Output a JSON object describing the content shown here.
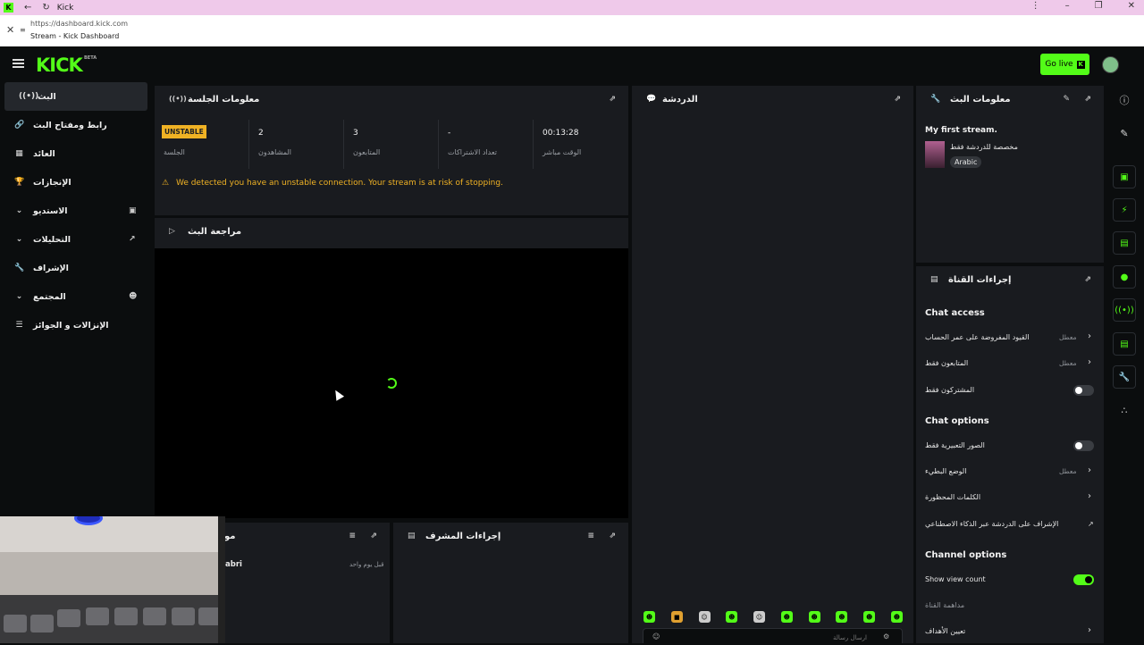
{
  "browser": {
    "tab_title": "Kick",
    "url": "https://dashboard.kick.com",
    "page_title": "Stream - Kick Dashboard"
  },
  "topnav": {
    "logo": "KICK",
    "logo_badge": "BETA",
    "go_live_label": "Go live"
  },
  "sidebar": {
    "items": [
      {
        "label": "البث",
        "icon": "broadcast-icon"
      },
      {
        "label": "رابط ومفتاح البث",
        "icon": "link-icon"
      },
      {
        "label": "العائد",
        "icon": "revenue-icon"
      },
      {
        "label": "الإنجازات",
        "icon": "trophy-icon"
      },
      {
        "label": "الاستديو",
        "icon": "studio-icon"
      },
      {
        "label": "التحليلات",
        "icon": "analytics-icon"
      },
      {
        "label": "الإشراف",
        "icon": "wrench-icon"
      },
      {
        "label": "المجتمع",
        "icon": "community-icon"
      },
      {
        "label": "الإنزالات و الجوائز",
        "icon": "drops-icon"
      }
    ]
  },
  "session": {
    "title": "معلومات الجلسة",
    "badge": "UNSTABLE",
    "stats": [
      {
        "value": "",
        "label": "الجلسة"
      },
      {
        "value": "2",
        "label": "المشاهدون"
      },
      {
        "value": "3",
        "label": "المتابعون"
      },
      {
        "value": "-",
        "label": "تعداد الاشتراكات"
      },
      {
        "value": "00:13:28",
        "label": "الوقت مباشر"
      }
    ],
    "warning": "We detected you have an unstable connection. Your stream is at risk of stopping."
  },
  "preview": {
    "title": "مراجعة البث"
  },
  "activity": {
    "title_fragment": "مو",
    "row_user": "abri",
    "row_time": "قبل يوم واحد"
  },
  "mod_actions": {
    "title": "إجراءات المشرف"
  },
  "chat": {
    "title": "الدردشة",
    "input_placeholder": "ارسال رسالة"
  },
  "stream_info": {
    "title": "معلومات البث",
    "stream_title": "My first stream.",
    "category": "مخصصة للدردشة فقط",
    "language_tag": "Arabic"
  },
  "channel_actions": {
    "title": "إجراءات القناة",
    "chat_access_heading": "Chat access",
    "chat_access": [
      {
        "label": "القيود المفروضة على عمر الحساب",
        "status": "معطل",
        "control": "chevron"
      },
      {
        "label": "المتابعون فقط",
        "status": "معطل",
        "control": "chevron"
      },
      {
        "label": "المشتركون فقط",
        "status": "",
        "control": "toggle-off"
      }
    ],
    "chat_options_heading": "Chat options",
    "chat_options": [
      {
        "label": "الصور التعبيرية فقط",
        "status": "",
        "control": "toggle-off"
      },
      {
        "label": "الوضع البطيء",
        "status": "معطل",
        "control": "chevron"
      },
      {
        "label": "الكلمات المحظورة",
        "status": "",
        "control": "chevron"
      },
      {
        "label": "الإشراف على الدردشة عبر الذكاء الاصطناعي",
        "status": "",
        "control": "external"
      }
    ],
    "channel_options_heading": "Channel options",
    "channel_options": [
      {
        "label": "Show view count",
        "status": "",
        "control": "toggle-on"
      },
      {
        "label": "مداهمة القناة",
        "status": "",
        "control": "none"
      },
      {
        "label": "تعيين الأهداف",
        "status": "",
        "control": "chevron"
      }
    ]
  },
  "colors": {
    "accent": "#53fc18",
    "warning": "#f0b224",
    "panel": "#191b1f",
    "background": "#0b0d0e"
  }
}
